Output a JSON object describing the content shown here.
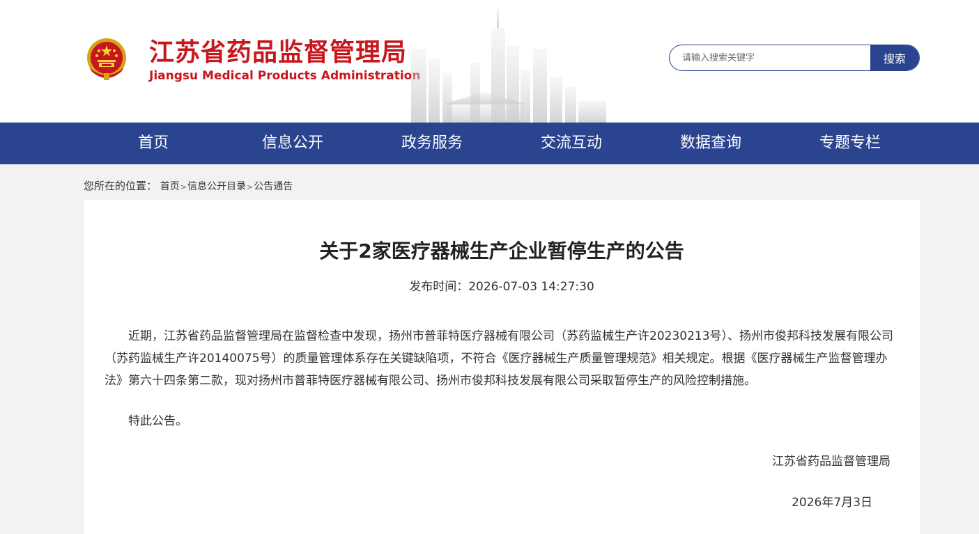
{
  "header": {
    "org_name_cn": "江苏省药品监督管理局",
    "org_name_en": "Jiangsu Medical Products Administration",
    "emblem_icon": "national-emblem-icon",
    "search": {
      "placeholder": "请输入搜索关键字",
      "value": "",
      "button_label": "搜索"
    }
  },
  "nav": {
    "items": [
      {
        "label": "首页"
      },
      {
        "label": "信息公开"
      },
      {
        "label": "政务服务"
      },
      {
        "label": "交流互动"
      },
      {
        "label": "数据查询"
      },
      {
        "label": "专题专栏"
      }
    ]
  },
  "breadcrumb": {
    "prefix": "您所在的位置：",
    "items": [
      {
        "label": "首页"
      },
      {
        "label": "信息公开目录"
      },
      {
        "label": "公告通告"
      }
    ],
    "separator": ">"
  },
  "article": {
    "title": "关于2家医疗器械生产企业暂停生产的公告",
    "publish_label": "发布时间：",
    "publish_time": "2026-07-03 14:27:30",
    "paragraphs": [
      "近期，江苏省药品监督管理局在监督检查中发现，扬州市普菲特医疗器械有限公司（苏药监械生产许20230213号）、扬州市俊邦科技发展有限公司（苏药监械生产许20140075号）的质量管理体系存在关键缺陷项，不符合《医疗器械生产质量管理规范》相关规定。根据《医疗器械生产监督管理办法》第六十四条第二款，现对扬州市普菲特医疗器械有限公司、扬州市俊邦科技发展有限公司采取暂停生产的风险控制措施。",
      "特此公告。"
    ],
    "signer": "江苏省药品监督管理局",
    "sign_date": "2026年7月3日"
  },
  "colors": {
    "brand_red": "#c8161d",
    "nav_blue": "#2b4490",
    "page_bg": "#f2f2f2"
  }
}
